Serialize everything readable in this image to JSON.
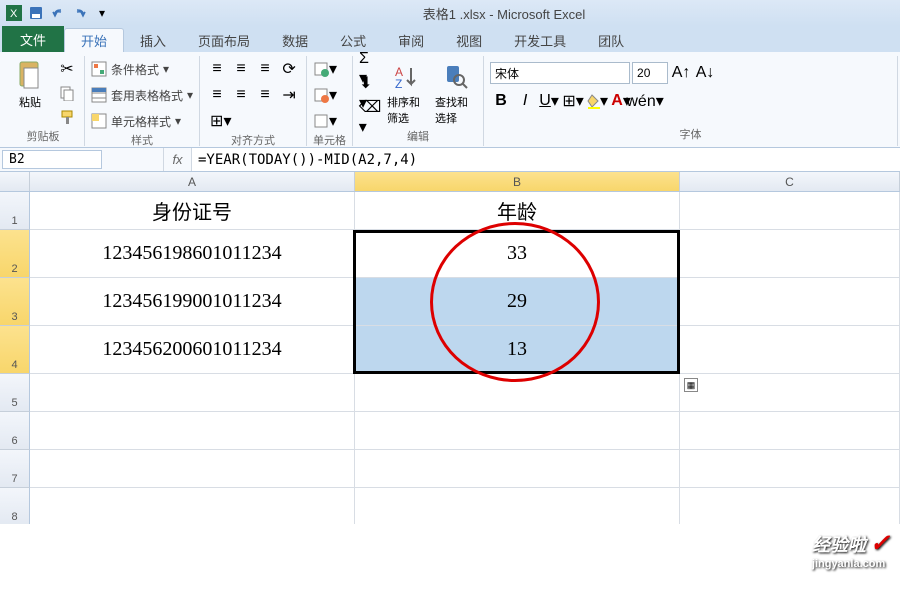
{
  "title": "表格1 .xlsx - Microsoft Excel",
  "qat": [
    "save",
    "undo",
    "redo",
    "print"
  ],
  "tabs": {
    "file": "文件",
    "items": [
      "开始",
      "插入",
      "页面布局",
      "数据",
      "公式",
      "审阅",
      "视图",
      "开发工具",
      "团队"
    ],
    "active": 0
  },
  "ribbon": {
    "clipboard": {
      "paste": "粘贴",
      "label": "剪贴板"
    },
    "styles": {
      "cond": "条件格式",
      "table": "套用表格格式",
      "cell": "单元格样式",
      "label": "样式"
    },
    "align": {
      "label": "对齐方式"
    },
    "cells": {
      "label": "单元格"
    },
    "editing": {
      "sort": "排序和筛选",
      "find": "查找和选择",
      "label": "编辑"
    },
    "font": {
      "name": "宋体",
      "size": "20",
      "label": "字体"
    }
  },
  "name_box": "B2",
  "formula": "=YEAR(TODAY())-MID(A2,7,4)",
  "columns": [
    "A",
    "B",
    "C"
  ],
  "rows": {
    "headers": [
      "1",
      "2",
      "3",
      "4",
      "5",
      "6",
      "7",
      "8"
    ],
    "data": [
      {
        "A": "身份证号",
        "B": "年龄"
      },
      {
        "A": "123456198601011234",
        "B": "33"
      },
      {
        "A": "123456199001011234",
        "B": "29"
      },
      {
        "A": "123456200601011234",
        "B": "13"
      }
    ]
  },
  "watermark": {
    "main": "经验啦",
    "sub": "jingyanla.com"
  }
}
